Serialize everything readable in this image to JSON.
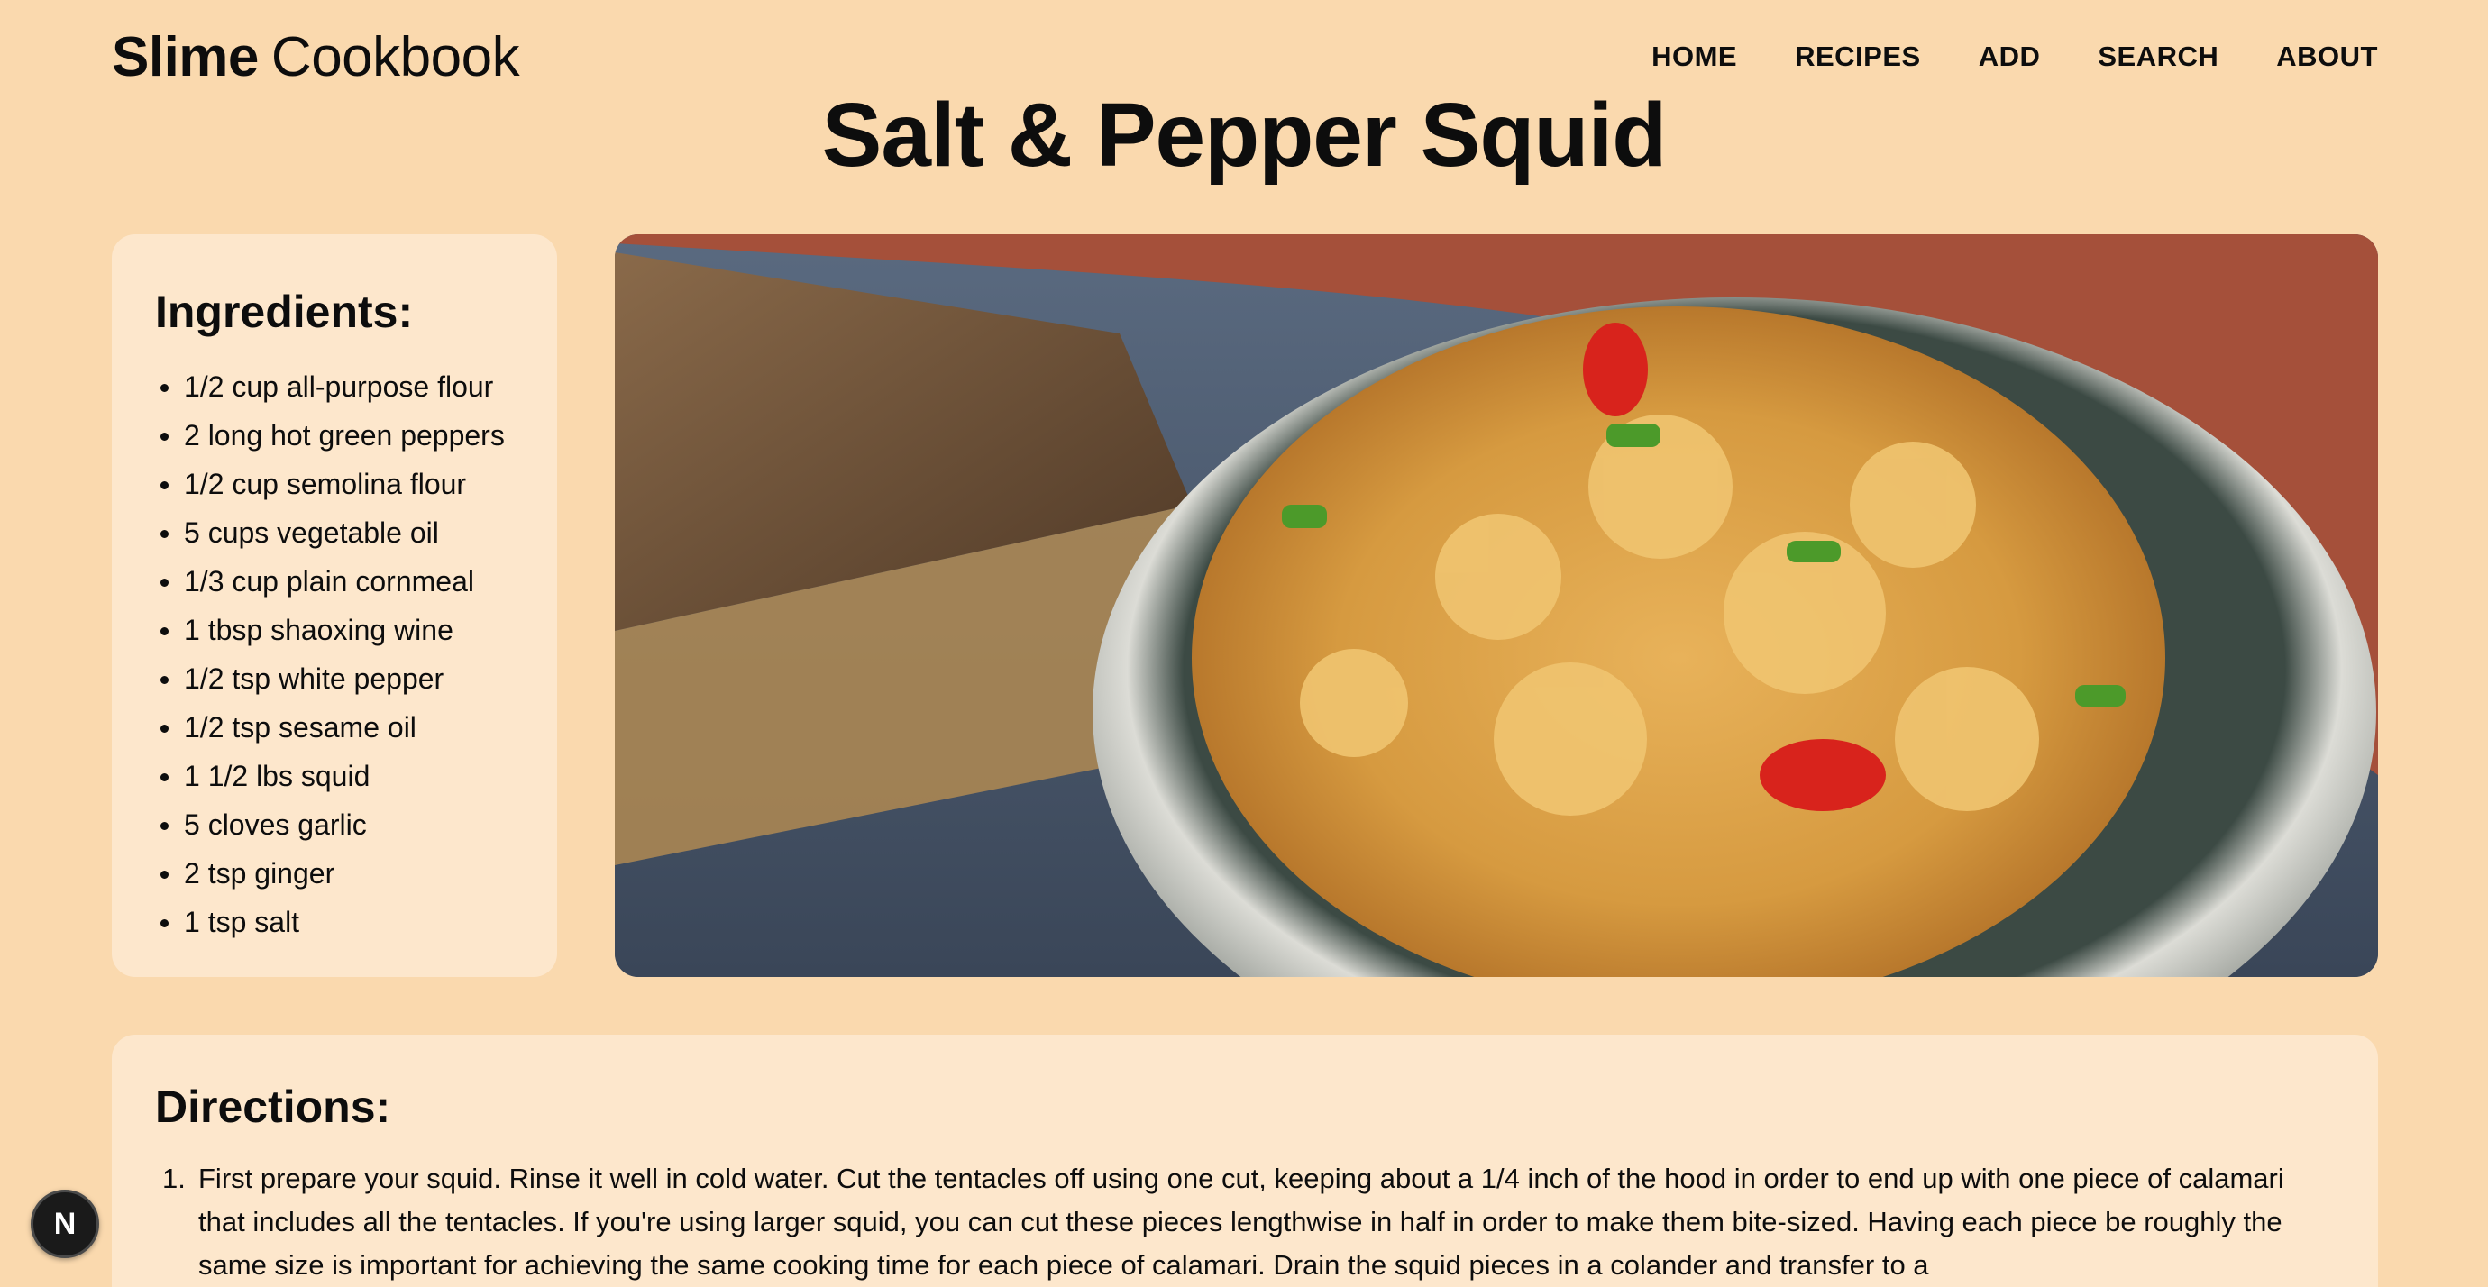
{
  "header": {
    "brand_strong": "Slime",
    "brand_light": "Cookbook",
    "nav": [
      "HOME",
      "RECIPES",
      "ADD",
      "SEARCH",
      "ABOUT"
    ]
  },
  "recipe": {
    "title": "Salt & Pepper Squid",
    "ingredients_heading": "Ingredients:",
    "ingredients": [
      "1/2 cup all-purpose flour",
      "2 long hot green peppers",
      "1/2 cup semolina flour",
      "5 cups vegetable oil",
      "1/3 cup plain cornmeal",
      "1 tbsp shaoxing wine",
      "1/2 tsp white pepper",
      "1/2 tsp sesame oil",
      "1 1/2 lbs squid",
      "5 cloves garlic",
      "2 tsp ginger",
      "1 tsp salt"
    ],
    "directions_heading": "Directions:",
    "directions": [
      {
        "number": "1.",
        "text": "First prepare your squid. Rinse it well in cold water. Cut the tentacles off using one cut, keeping about a 1/4 inch of the hood in order to end up with one piece of calamari that includes all the tentacles. If you're using larger squid, you can cut these pieces lengthwise in half in order to make them bite-sized. Having each piece be roughly the same size is important for achieving the same cooking time for each piece of calamari. Drain the squid pieces in a colander and transfer to a"
      }
    ]
  },
  "badge": {
    "letter": "N"
  },
  "colors": {
    "page_bg": "#fad9ae",
    "card_bg": "#fde7cc",
    "text": "#0d0d0d"
  }
}
